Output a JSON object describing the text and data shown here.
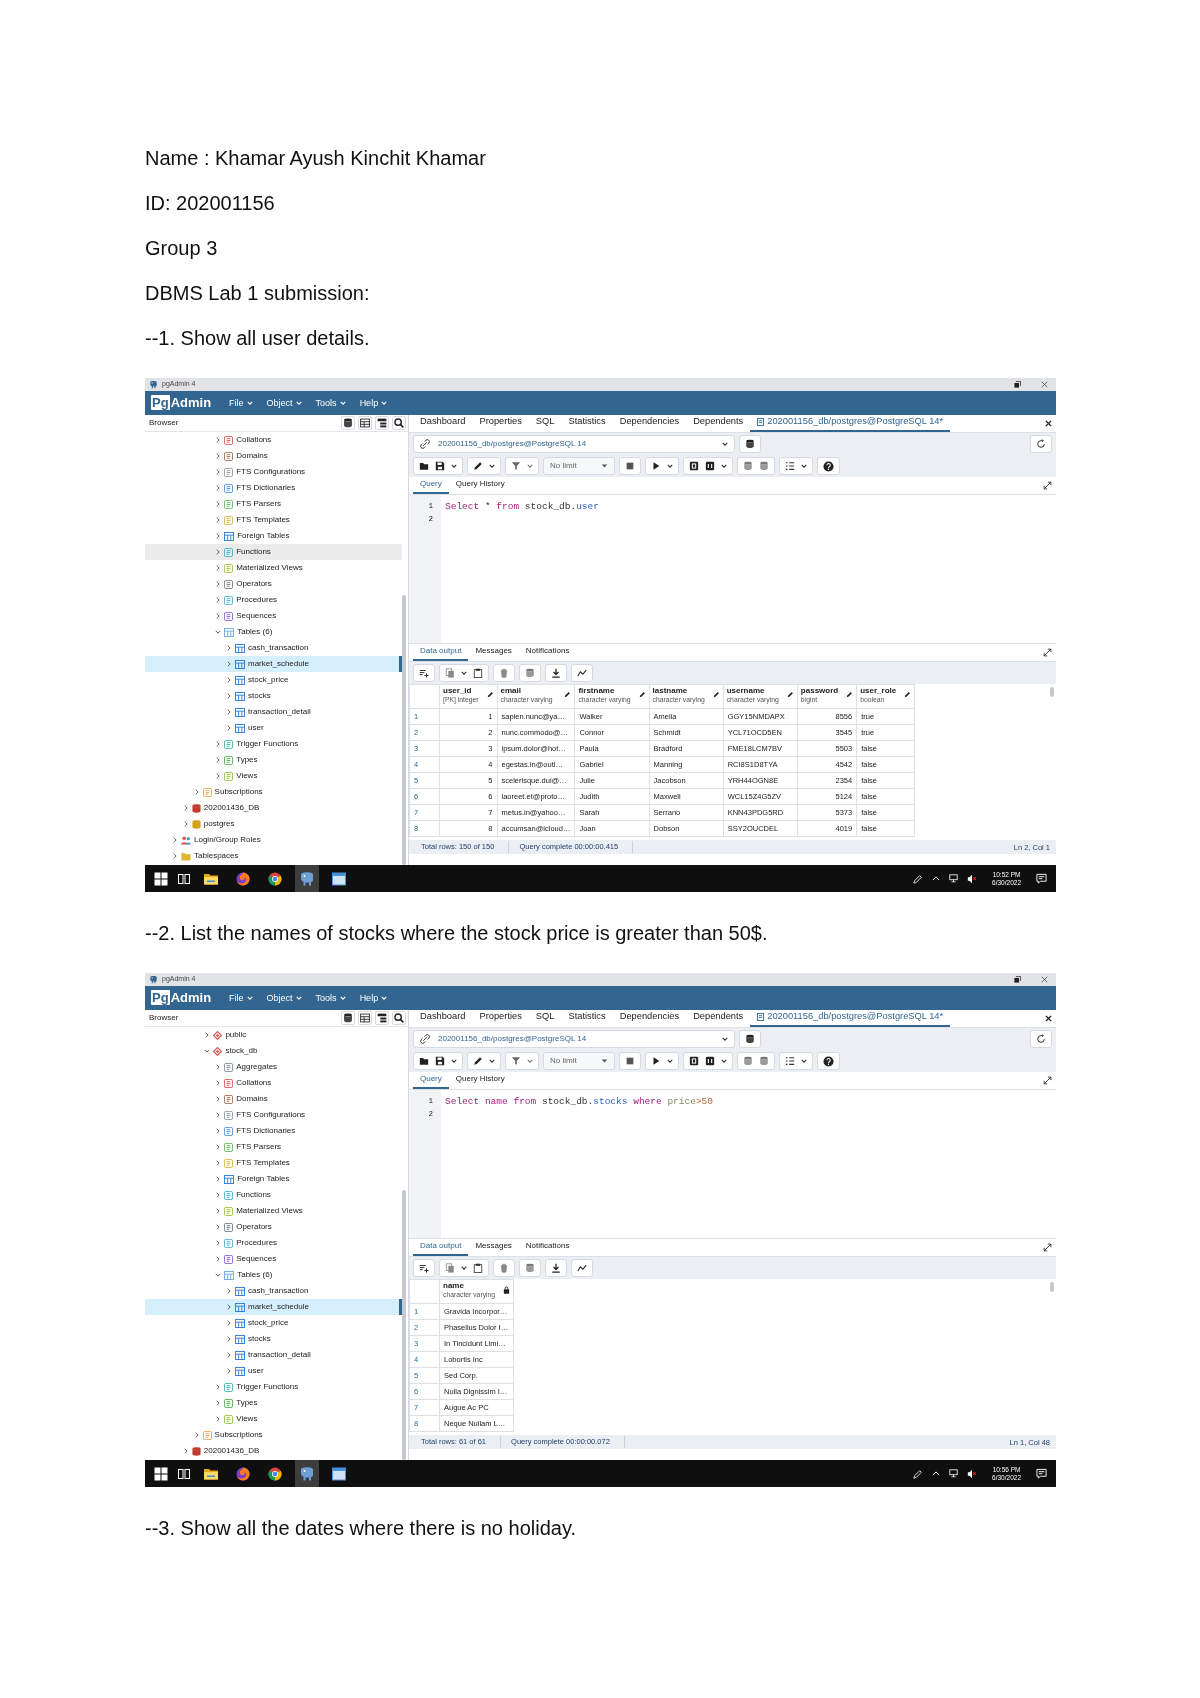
{
  "header": [
    "Name : Khamar Ayush Kinchit Khamar",
    "ID: 202001156",
    "Group 3",
    "DBMS Lab 1 submission:"
  ],
  "sections": [
    {
      "heading": "--1. Show all user details.",
      "screenshot": {
        "window_title": "pgAdmin 4",
        "logo_boxed": "Pg",
        "logo_text": "Admin",
        "menus": [
          "File",
          "Object",
          "Tools",
          "Help"
        ],
        "browser_title": "Browser",
        "tree": [
          {
            "children": [
              {
                "children": [
                  {
                    "children": [
                      {
                        "children": [
                          {
                            "label": "Collations",
                            "kind": "collation",
                            "expanded": false,
                            "selected": false,
                            "hovered": false
                          },
                          {
                            "label": "Domains",
                            "kind": "domain",
                            "expanded": false,
                            "selected": false,
                            "hovered": false
                          },
                          {
                            "label": "FTS Configurations",
                            "kind": "fts_config",
                            "expanded": false,
                            "selected": false,
                            "hovered": false
                          },
                          {
                            "label": "FTS Dictionaries",
                            "kind": "fts_dict",
                            "expanded": false,
                            "selected": false,
                            "hovered": false
                          },
                          {
                            "label": "FTS Parsers",
                            "kind": "fts_parser",
                            "expanded": false,
                            "selected": false,
                            "hovered": false
                          },
                          {
                            "label": "FTS Templates",
                            "kind": "fts_template",
                            "expanded": false,
                            "selected": false,
                            "hovered": false
                          },
                          {
                            "label": "Foreign Tables",
                            "kind": "foreign_table",
                            "expanded": false,
                            "selected": false,
                            "hovered": false
                          },
                          {
                            "label": "Functions",
                            "kind": "function",
                            "expanded": false,
                            "selected": false,
                            "hovered": true
                          },
                          {
                            "label": "Materialized Views",
                            "kind": "matview",
                            "expanded": false,
                            "selected": false,
                            "hovered": false
                          },
                          {
                            "label": "Operators",
                            "kind": "operator",
                            "expanded": false,
                            "selected": false,
                            "hovered": false
                          },
                          {
                            "label": "Procedures",
                            "kind": "procedure",
                            "expanded": false,
                            "selected": false,
                            "hovered": false
                          },
                          {
                            "label": "Sequences",
                            "kind": "sequence",
                            "expanded": false,
                            "selected": false,
                            "hovered": false
                          },
                          {
                            "label": "Tables (6)",
                            "kind": "tables",
                            "expanded": true,
                            "selected": false,
                            "hovered": false,
                            "children": [
                              {
                                "label": "cash_transaction",
                                "kind": "table",
                                "expanded": false,
                                "selected": false,
                                "hovered": false
                              },
                              {
                                "label": "market_schedule",
                                "kind": "table",
                                "expanded": false,
                                "selected": true,
                                "hovered": false
                              },
                              {
                                "label": "stock_price",
                                "kind": "table",
                                "expanded": false,
                                "selected": false,
                                "hovered": false
                              },
                              {
                                "label": "stocks",
                                "kind": "table",
                                "expanded": false,
                                "selected": false,
                                "hovered": false
                              },
                              {
                                "label": "transaction_detail",
                                "kind": "table",
                                "expanded": false,
                                "selected": false,
                                "hovered": false
                              },
                              {
                                "label": "user",
                                "kind": "table",
                                "expanded": false,
                                "selected": false,
                                "hovered": false
                              }
                            ]
                          },
                          {
                            "label": "Trigger Functions",
                            "kind": "trigger_function",
                            "expanded": false,
                            "selected": false,
                            "hovered": false
                          },
                          {
                            "label": "Types",
                            "kind": "type",
                            "expanded": false,
                            "selected": false,
                            "hovered": false
                          },
                          {
                            "label": "Views",
                            "kind": "view",
                            "expanded": false,
                            "selected": false,
                            "hovered": false
                          }
                        ]
                      }
                    ]
                  },
                  {
                    "label": "Subscriptions",
                    "kind": "subscription",
                    "expanded": false,
                    "selected": false,
                    "hovered": false
                  }
                ]
              },
              {
                "label": "202001436_DB",
                "kind": "database_off",
                "expanded": false,
                "selected": false,
                "hovered": false
              },
              {
                "label": "postgres",
                "kind": "database",
                "expanded": false,
                "selected": false,
                "hovered": false
              }
            ]
          },
          {
            "label": "Login/Group Roles",
            "kind": "role",
            "expanded": false,
            "selected": false,
            "hovered": false
          },
          {
            "label": "Tablespaces",
            "kind": "tablespace",
            "expanded": false,
            "selected": false,
            "hovered": false
          }
        ],
        "tabs": [
          {
            "label": "Dashboard",
            "kind": "panel",
            "selected": false
          },
          {
            "label": "Properties",
            "kind": "panel",
            "selected": false
          },
          {
            "label": "SQL",
            "kind": "panel",
            "selected": false
          },
          {
            "label": "Statistics",
            "kind": "panel",
            "selected": false
          },
          {
            "label": "Dependencies",
            "kind": "panel",
            "selected": false
          },
          {
            "label": "Dependents",
            "kind": "panel",
            "selected": false
          },
          {
            "label": "202001156_db/postgres@PostgreSQL 14*",
            "kind": "query",
            "selected": true
          }
        ],
        "connection": "202001156_db/postgres@PostgreSQL 14",
        "row_limit": "No limit",
        "editor_tabs": [
          {
            "label": "Query",
            "selected": true
          },
          {
            "label": "Query History",
            "selected": false
          }
        ],
        "code_lines": [
          {
            "number": "1",
            "tokens": [
              {
                "text": "Select",
                "kind": "keyword"
              },
              {
                "text": " * ",
                "kind": "plain"
              },
              {
                "text": "from",
                "kind": "keyword"
              },
              {
                "text": " stock_db.",
                "kind": "plain"
              },
              {
                "text": "user",
                "kind": "name"
              }
            ]
          },
          {
            "number": "2"
          }
        ],
        "output_tabs": [
          {
            "label": "Data output",
            "selected": true
          },
          {
            "label": "Messages",
            "selected": false
          },
          {
            "label": "Notifications",
            "selected": false
          }
        ],
        "grid": {
          "columns": [
            {
              "name": "user_id",
              "type": "[PK] integer",
              "numeric": true,
              "editable": true
            },
            {
              "name": "email",
              "type": "character varying",
              "numeric": false,
              "editable": true
            },
            {
              "name": "firstname",
              "type": "character varying",
              "numeric": false,
              "editable": true
            },
            {
              "name": "lastname",
              "type": "character varying",
              "numeric": false,
              "editable": true
            },
            {
              "name": "username",
              "type": "character varying",
              "numeric": false,
              "editable": true
            },
            {
              "name": "password",
              "type": "bigint",
              "numeric": true,
              "editable": true
            },
            {
              "name": "user_role",
              "type": "boolean",
              "numeric": false,
              "editable": true
            }
          ],
          "rows": [
            {
              "number": "1",
              "cells": [
                "1",
                "sapien.nunc@ya…",
                "Walker",
                "Amelia",
                "GGY15NMDAPX",
                "8556",
                "true"
              ]
            },
            {
              "number": "2",
              "cells": [
                "2",
                "nunc.commodo@…",
                "Connor",
                "Schmidt",
                "YCL71OCD5EN",
                "3545",
                "true"
              ]
            },
            {
              "number": "3",
              "cells": [
                "3",
                "ipsum.dolor@hot…",
                "Paula",
                "Bradford",
                "FME18LCM7BV",
                "5503",
                "false"
              ]
            },
            {
              "number": "4",
              "cells": [
                "4",
                "egestas.in@outl…",
                "Gabriel",
                "Manning",
                "RCI8S1D8TYA",
                "4542",
                "false"
              ]
            },
            {
              "number": "5",
              "cells": [
                "5",
                "scelerisque.dui@…",
                "Julie",
                "Jacobson",
                "YRH44OGN8E",
                "2354",
                "false"
              ]
            },
            {
              "number": "6",
              "cells": [
                "6",
                "laoreet.et@proto…",
                "Judith",
                "Maxwell",
                "WCL15Z4G5ZV",
                "5124",
                "false"
              ]
            },
            {
              "number": "7",
              "cells": [
                "7",
                "metus.in@yahoo…",
                "Sarah",
                "Serrano",
                "KNN43PDG5RD",
                "5373",
                "false"
              ]
            },
            {
              "number": "8",
              "cells": [
                "8",
                "accumsan@icloud…",
                "Joan",
                "Dobson",
                "SSY2OUCDEL",
                "4019",
                "false"
              ]
            }
          ]
        },
        "status": {
          "rows": "Total rows: 150 of 150",
          "query": "Query complete 00:00:00.415",
          "cursor": "Ln 2, Col 1"
        },
        "taskbar": {
          "apps": [
            {
              "kind": "start",
              "active": false
            },
            {
              "kind": "task_view",
              "active": false
            },
            {
              "kind": "folder",
              "active": false
            },
            {
              "kind": "fox",
              "active": false
            },
            {
              "kind": "round",
              "active": false
            },
            {
              "kind": "elephant",
              "active": true
            },
            {
              "kind": "window",
              "active": false
            }
          ],
          "time": "10:52 PM",
          "date": "6/30/2022"
        }
      }
    },
    {
      "heading": "--2. List the names of stocks where the stock price is greater than 50$.",
      "screenshot": {
        "window_title": "pgAdmin 4",
        "logo_boxed": "Pg",
        "logo_text": "Admin",
        "menus": [
          "File",
          "Object",
          "Tools",
          "Help"
        ],
        "browser_title": "Browser",
        "tree": [
          {
            "children": [
              {
                "children": [
                  {
                    "children": [
                      {
                        "label": "public",
                        "kind": "schema",
                        "expanded": false,
                        "selected": false,
                        "hovered": false
                      },
                      {
                        "label": "stock_db",
                        "kind": "schema",
                        "expanded": true,
                        "selected": false,
                        "hovered": false,
                        "children": [
                          {
                            "label": "Aggregates",
                            "kind": "aggregate",
                            "expanded": false,
                            "selected": false,
                            "hovered": false
                          },
                          {
                            "label": "Collations",
                            "kind": "collation",
                            "expanded": false,
                            "selected": false,
                            "hovered": false
                          },
                          {
                            "label": "Domains",
                            "kind": "domain",
                            "expanded": false,
                            "selected": false,
                            "hovered": false
                          },
                          {
                            "label": "FTS Configurations",
                            "kind": "fts_config",
                            "expanded": false,
                            "selected": false,
                            "hovered": false
                          },
                          {
                            "label": "FTS Dictionaries",
                            "kind": "fts_dict",
                            "expanded": false,
                            "selected": false,
                            "hovered": false
                          },
                          {
                            "label": "FTS Parsers",
                            "kind": "fts_parser",
                            "expanded": false,
                            "selected": false,
                            "hovered": false
                          },
                          {
                            "label": "FTS Templates",
                            "kind": "fts_template",
                            "expanded": false,
                            "selected": false,
                            "hovered": false
                          },
                          {
                            "label": "Foreign Tables",
                            "kind": "foreign_table",
                            "expanded": false,
                            "selected": false,
                            "hovered": false
                          },
                          {
                            "label": "Functions",
                            "kind": "function",
                            "expanded": false,
                            "selected": false,
                            "hovered": false
                          },
                          {
                            "label": "Materialized Views",
                            "kind": "matview",
                            "expanded": false,
                            "selected": false,
                            "hovered": false
                          },
                          {
                            "label": "Operators",
                            "kind": "operator",
                            "expanded": false,
                            "selected": false,
                            "hovered": false
                          },
                          {
                            "label": "Procedures",
                            "kind": "procedure",
                            "expanded": false,
                            "selected": false,
                            "hovered": false
                          },
                          {
                            "label": "Sequences",
                            "kind": "sequence",
                            "expanded": false,
                            "selected": false,
                            "hovered": false
                          },
                          {
                            "label": "Tables (6)",
                            "kind": "tables",
                            "expanded": true,
                            "selected": false,
                            "hovered": false,
                            "children": [
                              {
                                "label": "cash_transaction",
                                "kind": "table",
                                "expanded": false,
                                "selected": false,
                                "hovered": false
                              },
                              {
                                "label": "market_schedule",
                                "kind": "table",
                                "expanded": false,
                                "selected": true,
                                "hovered": false
                              },
                              {
                                "label": "stock_price",
                                "kind": "table",
                                "expanded": false,
                                "selected": false,
                                "hovered": false
                              },
                              {
                                "label": "stocks",
                                "kind": "table",
                                "expanded": false,
                                "selected": false,
                                "hovered": false
                              },
                              {
                                "label": "transaction_detail",
                                "kind": "table",
                                "expanded": false,
                                "selected": false,
                                "hovered": false
                              },
                              {
                                "label": "user",
                                "kind": "table",
                                "expanded": false,
                                "selected": false,
                                "hovered": false
                              }
                            ]
                          },
                          {
                            "label": "Trigger Functions",
                            "kind": "trigger_function",
                            "expanded": false,
                            "selected": false,
                            "hovered": false
                          },
                          {
                            "label": "Types",
                            "kind": "type",
                            "expanded": false,
                            "selected": false,
                            "hovered": false
                          },
                          {
                            "label": "Views",
                            "kind": "view",
                            "expanded": false,
                            "selected": false,
                            "hovered": false
                          }
                        ]
                      }
                    ]
                  },
                  {
                    "label": "Subscriptions",
                    "kind": "subscription",
                    "expanded": false,
                    "selected": false,
                    "hovered": false
                  }
                ]
              },
              {
                "label": "202001436_DB",
                "kind": "database_off",
                "expanded": false,
                "selected": false,
                "hovered": false
              }
            ]
          }
        ],
        "tabs": [
          {
            "label": "Dashboard",
            "kind": "panel",
            "selected": false
          },
          {
            "label": "Properties",
            "kind": "panel",
            "selected": false
          },
          {
            "label": "SQL",
            "kind": "panel",
            "selected": false
          },
          {
            "label": "Statistics",
            "kind": "panel",
            "selected": false
          },
          {
            "label": "Dependencies",
            "kind": "panel",
            "selected": false
          },
          {
            "label": "Dependents",
            "kind": "panel",
            "selected": false
          },
          {
            "label": "202001156_db/postgres@PostgreSQL 14*",
            "kind": "query",
            "selected": true
          }
        ],
        "connection": "202001156_db/postgres@PostgreSQL 14",
        "row_limit": "No limit",
        "editor_tabs": [
          {
            "label": "Query",
            "selected": true
          },
          {
            "label": "Query History",
            "selected": false
          }
        ],
        "code_lines": [
          {
            "number": "1",
            "tokens": [
              {
                "text": "Select",
                "kind": "keyword"
              },
              {
                "text": " name",
                "kind": "keyword"
              },
              {
                "text": " from",
                "kind": "keyword"
              },
              {
                "text": " stock_db.",
                "kind": "plain"
              },
              {
                "text": "stocks",
                "kind": "name"
              },
              {
                "text": " where",
                "kind": "keyword"
              },
              {
                "text": " price",
                "kind": "column"
              },
              {
                "text": ">50",
                "kind": "number"
              }
            ]
          },
          {
            "number": "2"
          }
        ],
        "output_tabs": [
          {
            "label": "Data output",
            "selected": true
          },
          {
            "label": "Messages",
            "selected": false
          },
          {
            "label": "Notifications",
            "selected": false
          }
        ],
        "grid": {
          "columns": [
            {
              "name": "name",
              "type": "character varying",
              "numeric": false,
              "editable": false
            }
          ],
          "rows": [
            {
              "number": "1",
              "cells": [
                "Gravida Incorpor…"
              ]
            },
            {
              "number": "2",
              "cells": [
                "Phasellus Dolor I…"
              ]
            },
            {
              "number": "3",
              "cells": [
                "In Tincidunt Limi…"
              ]
            },
            {
              "number": "4",
              "cells": [
                "Lobortis Inc"
              ]
            },
            {
              "number": "5",
              "cells": [
                "Sed Corp."
              ]
            },
            {
              "number": "6",
              "cells": [
                "Nulla Dignissim I…"
              ]
            },
            {
              "number": "7",
              "cells": [
                "Augue Ac PC"
              ]
            },
            {
              "number": "8",
              "cells": [
                "Neque Nullam L…"
              ]
            }
          ]
        },
        "status": {
          "rows": "Total rows: 61 of 61",
          "query": "Query complete 00:00:00.072",
          "cursor": "Ln 1, Col 48"
        },
        "taskbar": {
          "apps": [
            {
              "kind": "start",
              "active": false
            },
            {
              "kind": "task_view",
              "active": false
            },
            {
              "kind": "folder",
              "active": false
            },
            {
              "kind": "fox",
              "active": false
            },
            {
              "kind": "round",
              "active": false
            },
            {
              "kind": "elephant",
              "active": true
            },
            {
              "kind": "window",
              "active": false
            }
          ],
          "time": "10:56 PM",
          "date": "6/30/2022"
        }
      }
    },
    {
      "heading": "--3. Show all the dates where there is no holiday."
    }
  ]
}
